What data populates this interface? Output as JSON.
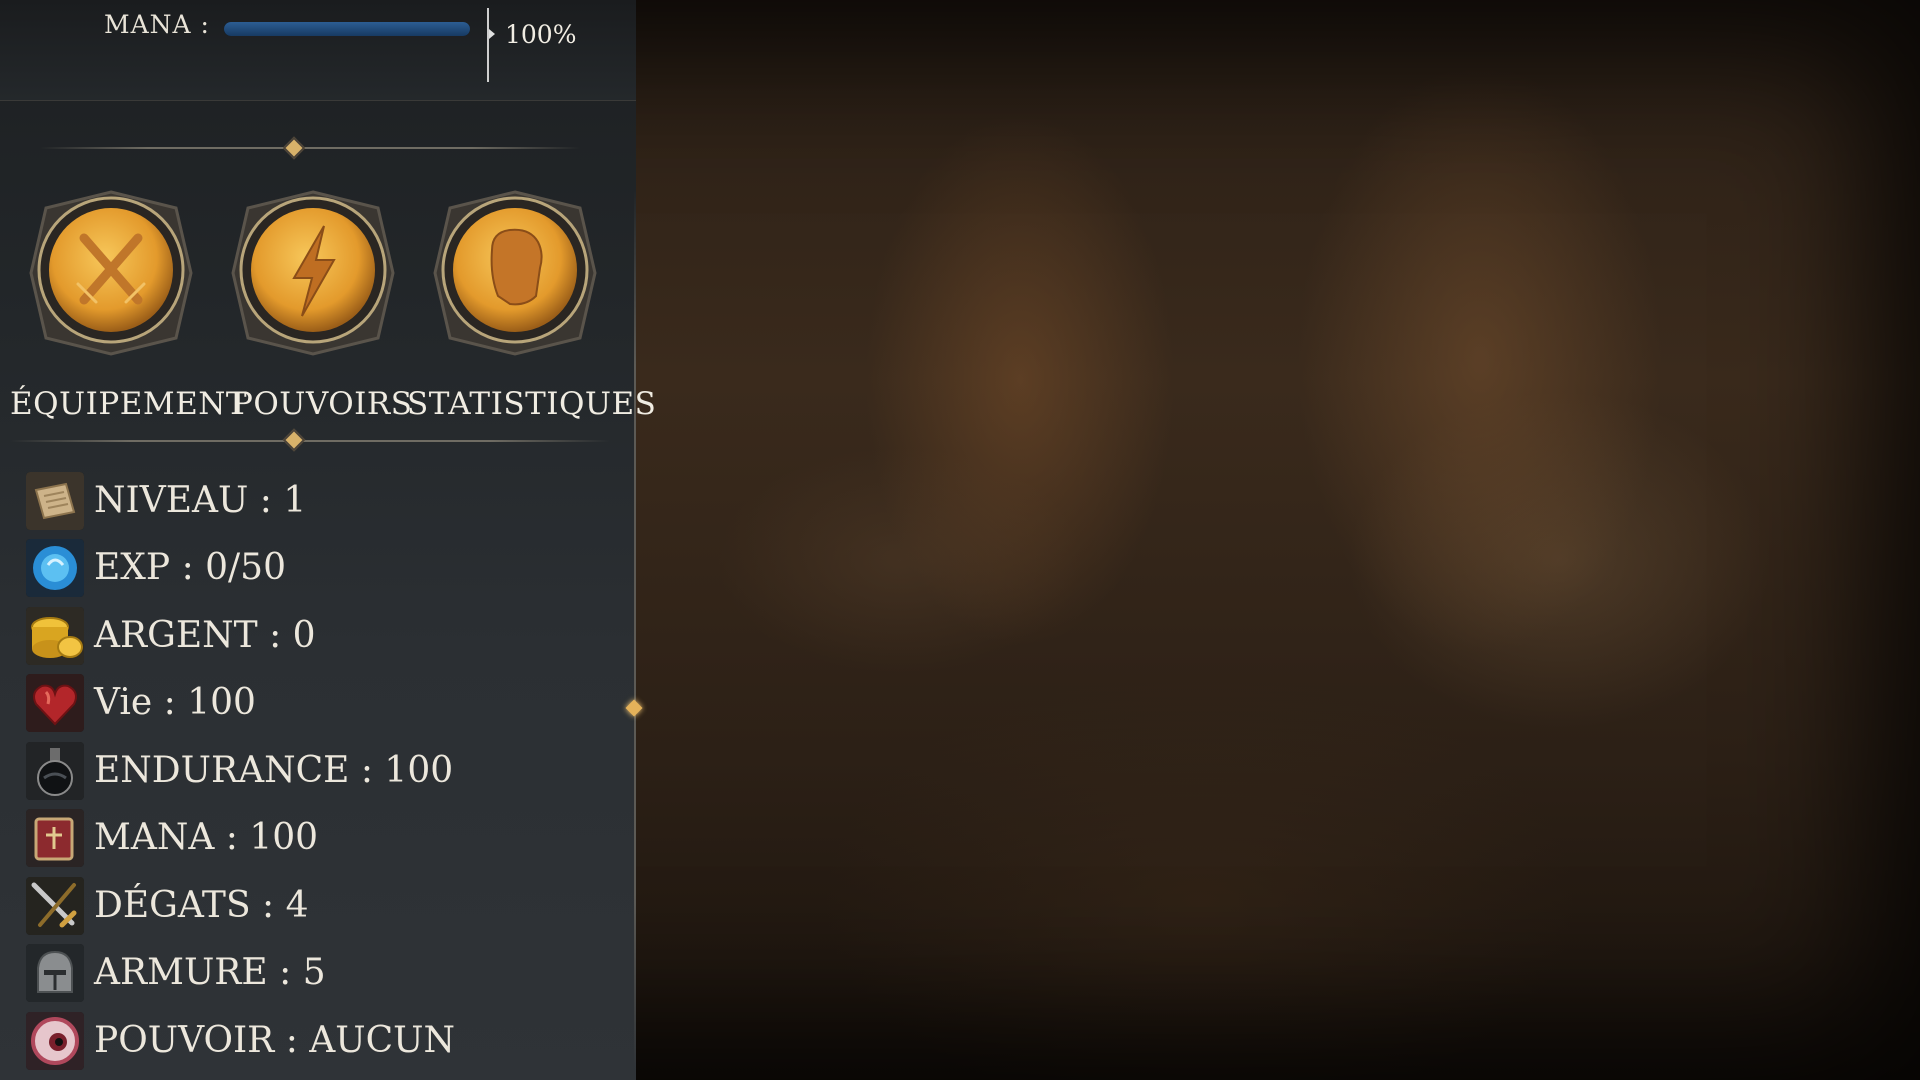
{
  "mana_bar": {
    "label": "MANA :",
    "percent_text": "100%",
    "fill_fraction": 1.0,
    "fill_color": "#2c5d93"
  },
  "tabs": [
    {
      "label": "ÉQUIPEMENT",
      "icon": "crossed-swords-icon"
    },
    {
      "label": "POUVOIRS",
      "icon": "lightning-bolt-icon"
    },
    {
      "label": "STATISTIQUES",
      "icon": "fist-icon"
    }
  ],
  "stats": [
    {
      "text": "NIVEAU : 1",
      "icon": "scroll-icon"
    },
    {
      "text": "EXP : 0/50",
      "icon": "blue-orb-icon"
    },
    {
      "text": "ARGENT : 0",
      "icon": "gold-coins-icon"
    },
    {
      "text": "Vie : 100",
      "icon": "heart-icon"
    },
    {
      "text": "ENDURANCE : 100",
      "icon": "potion-flask-icon"
    },
    {
      "text": "MANA : 100",
      "icon": "spellbook-icon"
    },
    {
      "text": "DÉGATS : 4",
      "icon": "sword-icon"
    },
    {
      "text": "ARMURE : 5",
      "icon": "helmet-icon"
    },
    {
      "text": "POUVOIR : AUCUN",
      "icon": "eye-icon"
    }
  ],
  "colors": {
    "medallion_gold": "#e8a838",
    "accent_gem": "#e5b25a"
  }
}
